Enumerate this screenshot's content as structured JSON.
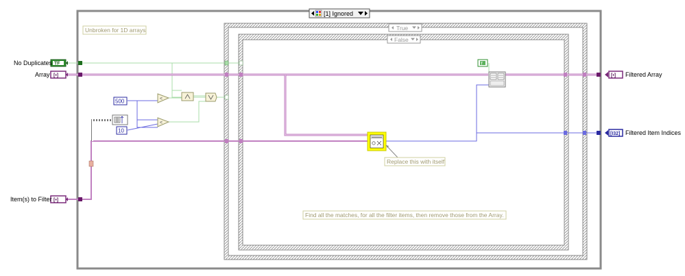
{
  "structure": {
    "case_selector": "[1] Ignored",
    "inner_case_true": "True",
    "inner_case_false": "False"
  },
  "comments": {
    "unbroken": "Unbroken for 1D arrays",
    "replace": "Replace this with itself",
    "find": "Find all the matches, for all the filter items, then remove those from the Array."
  },
  "inputs": [
    {
      "label": "No Duplicates",
      "terminal": "TF"
    },
    {
      "label": "Array",
      "terminal": "[•]"
    },
    {
      "label": "Item(s) to Filter",
      "terminal": "[•]"
    }
  ],
  "outputs": [
    {
      "label": "Filtered Array",
      "terminal": "[•]"
    },
    {
      "label": "Filtered Item Indices",
      "terminal": "[I32]"
    }
  ],
  "constants": {
    "c500": "500",
    "c10": "10",
    "c_true": "T"
  },
  "colors": {
    "structure_frame": "#8a8a8a",
    "boolean_wire": "#a8dca8",
    "array_wire": "#c080c0",
    "i32_wire": "#6a6ae0",
    "highlight": "#ffff00"
  }
}
